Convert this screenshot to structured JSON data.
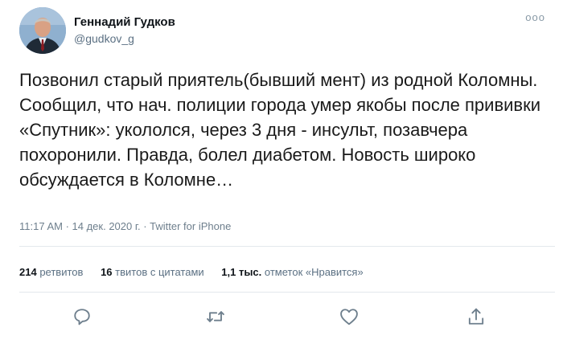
{
  "author": {
    "name": "Геннадий Гудков",
    "handle": "@gudkov_g"
  },
  "more_label": "ooo",
  "tweet": {
    "text": "Позвонил старый приятель(бывший мент) из родной Коломны. Сообщил, что нач. полиции города умер якобы после прививки «Спутник»: укололся, через 3 дня - инсульт, позавчера похоронили. Правда, болел диабетом. Новость широко обсуждается в Коломне…",
    "meta": "11:17 AM · 14 дек. 2020 г. · Twitter for iPhone"
  },
  "stats": {
    "retweets": {
      "count": "214",
      "label": "ретвитов"
    },
    "quotes": {
      "count": "16",
      "label": "твитов с цитатами"
    },
    "likes": {
      "count": "1,1 тыс.",
      "label": "отметок «Нравится»"
    }
  },
  "icons": [
    "reply-icon",
    "retweet-icon",
    "like-icon",
    "share-icon"
  ],
  "colors": {
    "icon": "#6e7f8d",
    "muted_text": "#5b7083",
    "divider": "#e3e8ec"
  }
}
